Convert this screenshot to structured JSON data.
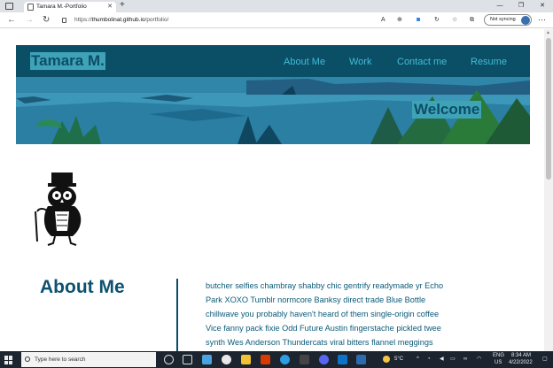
{
  "browser": {
    "tab_title": "Tamara M.-Portfolio",
    "url_prefix": "https://",
    "url_host": "thumbolinat.github.io",
    "url_path": "/portfolio/",
    "sync_label": "Not syncing"
  },
  "site": {
    "brand": "Tamara M.",
    "nav": [
      "About Me",
      "Work",
      "Contact me",
      "Resume"
    ],
    "hero_heading": "Welcome",
    "about_title": "About Me",
    "about_text": "butcher selfies chambray shabby chic gentrify readymade yr Echo Park XOXO Tumblr normcore Banksy direct trade Blue Bottle chillwave you probably haven't heard of them single-origin coffee Vice fanny pack fixie Odd Future Austin fingerstache pickled twee synth Wes Anderson Thundercats viral bitters flannel meggings"
  },
  "taskbar": {
    "search_placeholder": "Type here to search",
    "weather": "5°C",
    "lang_top": "ENG",
    "lang_bottom": "US",
    "time": "8:34 AM",
    "date": "4/22/2022"
  },
  "colors": {
    "brand_dark": "#0d4d66",
    "nav_text": "#40bcd6",
    "label_bg": "#3fa3b8",
    "body_text": "#0b5a78"
  }
}
